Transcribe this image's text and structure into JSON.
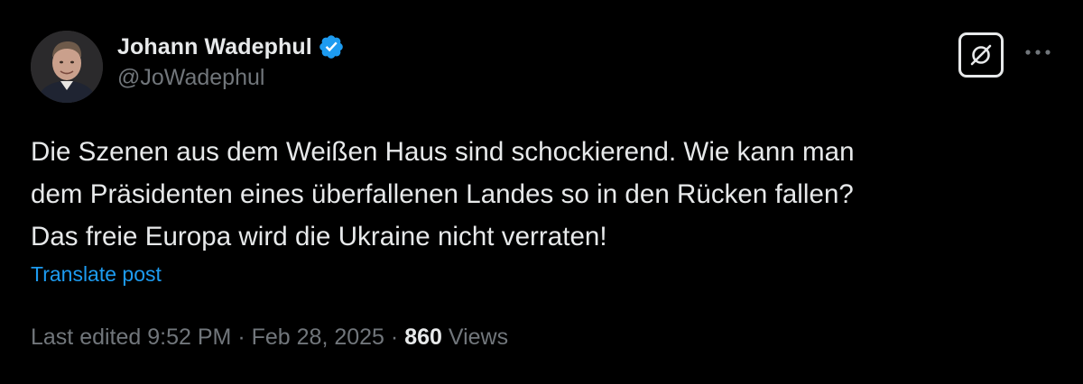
{
  "author": {
    "display_name": "Johann Wadephul",
    "handle": "@JoWadephul",
    "verified_icon": "verified-badge-icon",
    "verified_color": "#1d9bf0",
    "avatar_icon": "profile-photo"
  },
  "actions": {
    "grok_icon": "grok-icon",
    "more_icon": "more-dots-icon"
  },
  "post": {
    "lines": [
      "Die Szenen aus dem Weißen Haus sind schockierend. Wie kann man",
      "dem Präsidenten eines überfallenen Landes so in den Rücken fallen?",
      "Das freie Europa wird die Ukraine nicht verraten!"
    ],
    "translate_label": "Translate post"
  },
  "meta": {
    "edited_label": "Last edited",
    "time": "9:52 PM",
    "separator": "·",
    "date": "Feb 28, 2025",
    "views_count": "860",
    "views_label": "Views"
  },
  "colors": {
    "background": "#000000",
    "text_primary": "#e7e9ea",
    "text_secondary": "#71767b",
    "link": "#1d9bf0"
  }
}
